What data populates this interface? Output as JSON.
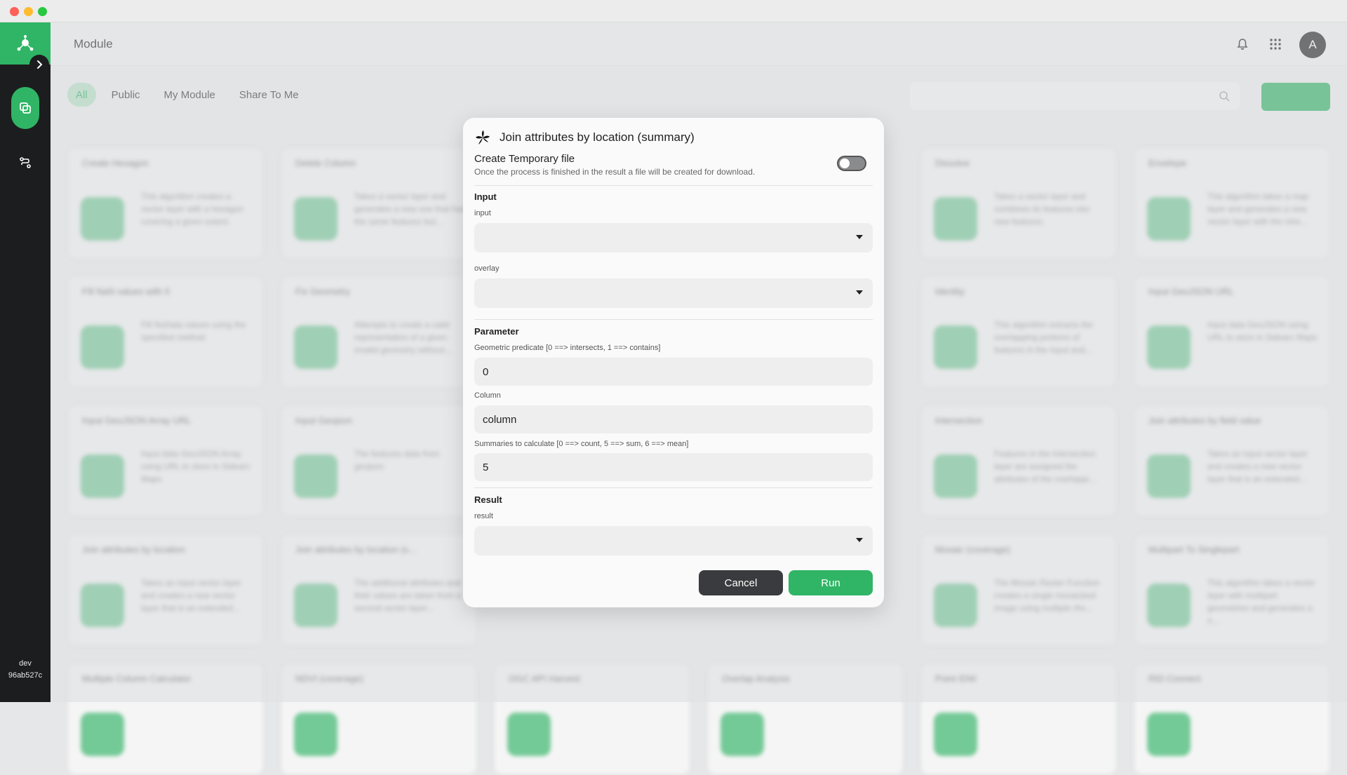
{
  "app": {
    "page_title": "Module",
    "avatar_initial": "A",
    "env_label": "dev",
    "build_id": "96ab527c"
  },
  "tabs": [
    {
      "label": "All"
    },
    {
      "label": "Public"
    },
    {
      "label": "My Module"
    },
    {
      "label": "Share To Me"
    }
  ],
  "cards": [
    {
      "title": "Create Hexagon",
      "desc": "This algorithm creates a vector layer with a hexagon covering a given extent."
    },
    {
      "title": "Delete Column",
      "desc": "Takes a vector layer and generates a new one that has the same features but..."
    },
    {
      "title": "Dissolve",
      "desc": "Takes a vector layer and combines its features into new features."
    },
    {
      "title": "Envelope",
      "desc": "This algorithm takes a map layer and generates a new vector layer with the mini..."
    },
    {
      "title": "Fill NaN values with 0",
      "desc": "Fill NoData values using the specified method."
    },
    {
      "title": "Fix Geometry",
      "desc": "Attempts to create a valid representation of a given invalid geometry without..."
    },
    {
      "title": "Identity",
      "desc": "This algorithm extracts the overlapping portions of features in the Input and..."
    },
    {
      "title": "Input GeoJSON URL",
      "desc": "Input data GeoJSON using URL to store in Sidearc Maps"
    },
    {
      "title": "Input GeoJSON Array URL",
      "desc": "Input data GeoJSON Array using URL to store in Sidearc Maps"
    },
    {
      "title": "Input Geojson",
      "desc": "The features data from geojson"
    },
    {
      "title": "Intersection",
      "desc": "Features in the intersection layer are assigned the attributes of the overlappi..."
    },
    {
      "title": "Join attributes by field value",
      "desc": "Takes an input vector layer and creates a new vector layer that is an extended..."
    },
    {
      "title": "Join attributes by location",
      "desc": "Takes an input vector layer and creates a new vector layer that is an extended..."
    },
    {
      "title": "Join attributes by location (s...",
      "desc": "The additional attributes and their values are taken from a second vector layer..."
    },
    {
      "title": "Mosaic (coverage)",
      "desc": "The Mosaic Raster Function creates a single mosaicked image using multiple rfrs..."
    },
    {
      "title": "Multipart To Singlepart",
      "desc": "This algorithm takes a vector layer with multipart geometries and generates a n..."
    },
    {
      "title": "Multiple Column Calculator",
      "desc": ""
    },
    {
      "title": "NDVI (coverage)",
      "desc": ""
    },
    {
      "title": "OGC API Harvest",
      "desc": ""
    },
    {
      "title": "Overlap Analysis",
      "desc": ""
    },
    {
      "title": "Point IDW",
      "desc": ""
    },
    {
      "title": "RID Connect",
      "desc": ""
    }
  ],
  "dialog": {
    "title": "Join attributes by location (summary)",
    "temp_file": {
      "label": "Create Temporary file",
      "description": "Once the process is finished in the result a file will be created for download.",
      "enabled": false
    },
    "sections": {
      "input": "Input",
      "parameter": "Parameter",
      "result": "Result"
    },
    "fields": {
      "input_label": "input",
      "input_value": "",
      "overlay_label": "overlay",
      "overlay_value": "",
      "predicate_label": "Geometric predicate [0 ==> intersects, 1 ==> contains]",
      "predicate_value": "0",
      "column_label": "Column",
      "column_value": "column",
      "summaries_label": "Summaries to calculate [0 ==> count, 5 ==> sum, 6 ==> mean]",
      "summaries_value": "5",
      "result_label": "result",
      "result_value": ""
    },
    "buttons": {
      "cancel": "Cancel",
      "run": "Run"
    }
  },
  "colors": {
    "accent": "#2fb565",
    "sidebar": "#1c1d1e",
    "cancel_button": "#3a3b3e"
  },
  "icons": [
    "bell-icon",
    "apps-grid-icon",
    "leaf-icon",
    "chevron-right-icon",
    "layers-icon",
    "workflow-icon",
    "search-icon"
  ]
}
